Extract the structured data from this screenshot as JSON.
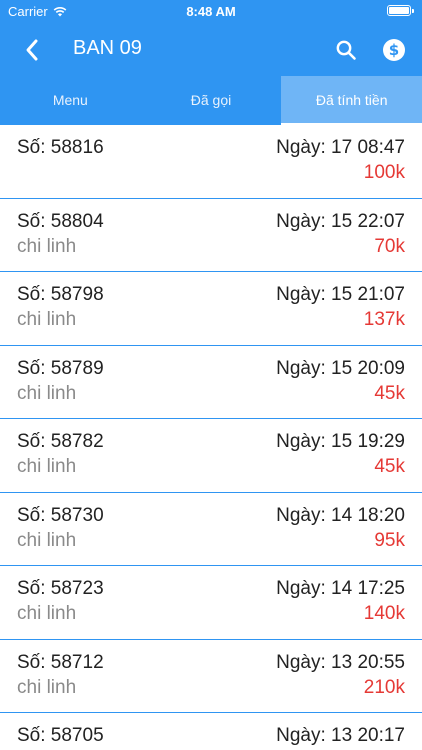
{
  "status_bar": {
    "carrier": "Carrier",
    "time": "8:48 AM"
  },
  "nav": {
    "title": "BAN 09",
    "back_icon": "chevron-left-icon",
    "search_icon": "search-icon",
    "pay_icon": "dollar-circle-icon"
  },
  "tabs": [
    {
      "label": "Menu",
      "active": false
    },
    {
      "label": "Đã gọi",
      "active": false
    },
    {
      "label": "Đã tính tiền",
      "active": true
    }
  ],
  "orders": [
    {
      "number": "Số: 58816",
      "name": "",
      "date": "Ngày: 17 08:47",
      "amount": "100k"
    },
    {
      "number": "Số: 58804",
      "name": "chi linh",
      "date": "Ngày: 15 22:07",
      "amount": "70k"
    },
    {
      "number": "Số: 58798",
      "name": "chi linh",
      "date": "Ngày: 15 21:07",
      "amount": "137k"
    },
    {
      "number": "Số: 58789",
      "name": "chi linh",
      "date": "Ngày: 15 20:09",
      "amount": "45k"
    },
    {
      "number": "Số: 58782",
      "name": "chi linh",
      "date": "Ngày: 15 19:29",
      "amount": "45k"
    },
    {
      "number": "Số: 58730",
      "name": "chi linh",
      "date": "Ngày: 14 18:20",
      "amount": "95k"
    },
    {
      "number": "Số: 58723",
      "name": "chi linh",
      "date": "Ngày: 14 17:25",
      "amount": "140k"
    },
    {
      "number": "Số: 58712",
      "name": "chi linh",
      "date": "Ngày: 13 20:55",
      "amount": "210k"
    },
    {
      "number": "Số: 58705",
      "name": "",
      "date": "Ngày: 13 20:17",
      "amount": ""
    }
  ],
  "colors": {
    "primary": "#2f95f2",
    "active_tab": "#6fb5f6",
    "amount": "#e53935",
    "secondary_text": "#8a8a8a"
  }
}
